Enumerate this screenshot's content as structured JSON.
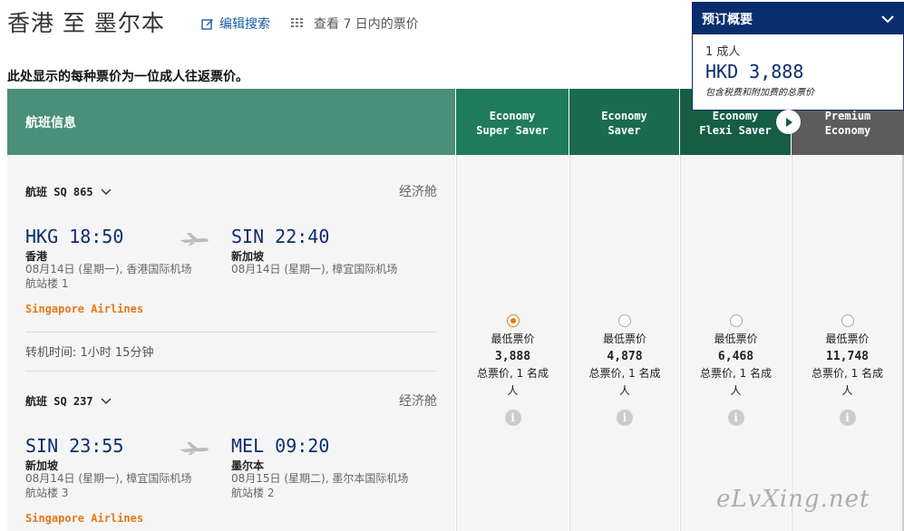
{
  "header": {
    "route_title": "香港 至 墨尔本",
    "edit_search": "编辑搜索",
    "view_7days": "查看 7 日内的票价",
    "notice": "此处显示的每种票价为一位成人往返票价。"
  },
  "summary": {
    "title": "预订概要",
    "passengers": "1 成人",
    "total": "HKD 3,888",
    "note": "包含税费和附加费的总票价"
  },
  "table": {
    "info_header": "航班信息",
    "fare_classes": [
      {
        "line1": "Economy",
        "line2": "Super Saver"
      },
      {
        "line1": "Economy",
        "line2": "Saver"
      },
      {
        "line1": "Economy",
        "line2": "Flexi Saver"
      },
      {
        "line1": "Premium",
        "line2": "Economy"
      }
    ]
  },
  "segments": [
    {
      "flight": "航班 SQ 865",
      "cabin": "经济舱",
      "dep_time": "HKG 18:50",
      "dep_city": "香港",
      "dep_detail1": "08月14日 (星期一), 香港国际机场",
      "dep_detail2": "航站楼 1",
      "arr_time": "SIN 22:40",
      "arr_city": "新加坡",
      "arr_detail1": "08月14日 (星期一), 樟宜国际机场",
      "airline": "Singapore Airlines"
    },
    {
      "flight": "航班 SQ 237",
      "cabin": "经济舱",
      "dep_time": "SIN 23:55",
      "dep_city": "新加坡",
      "dep_detail1": "08月14日 (星期一), 樟宜国际机场",
      "dep_detail2": "航站楼 3",
      "arr_time": "MEL 09:20",
      "arr_city": "墨尔本",
      "arr_detail1": "08月15日 (星期二), 墨尔本国际机场",
      "arr_detail2": "航站楼 2",
      "airline": "Singapore Airlines"
    }
  ],
  "transfer": "转机时间: 1小时 15分钟",
  "fares": [
    {
      "label": "最低票价",
      "price": "3,888",
      "total_line1": "总票价, 1 名成",
      "total_line2": "人",
      "selected": true
    },
    {
      "label": "最低票价",
      "price": "4,878",
      "total_line1": "总票价, 1 名成",
      "total_line2": "人",
      "selected": false
    },
    {
      "label": "最低票价",
      "price": "6,468",
      "total_line1": "总票价, 1 名成",
      "total_line2": "人",
      "selected": false
    },
    {
      "label": "最低票价",
      "price": "11,748",
      "total_line1": "总票价, 1 名成",
      "total_line2": "人",
      "selected": false
    }
  ],
  "info_icon": "i",
  "watermark": "eLvXing.net",
  "icons": {
    "edit": "edit-icon",
    "calendar": "calendar-icon",
    "chevron": "chevron-down-icon",
    "plane": "plane-icon",
    "arrow": "arrow-right-icon",
    "info": "info-icon"
  },
  "colors": {
    "brand_navy": "#0a2d6e",
    "airline_orange": "#e67817",
    "header_green": "#4a8f79"
  }
}
